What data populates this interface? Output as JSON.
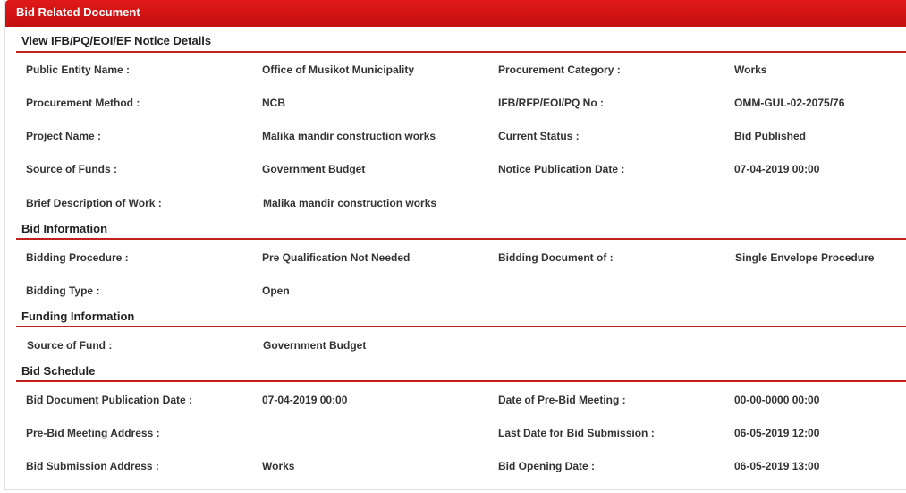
{
  "panel": {
    "title": "Bid Related Document"
  },
  "sections": {
    "notice": {
      "title": "View IFB/PQ/EOI/EF Notice Details",
      "public_entity_label": "Public Entity Name :",
      "public_entity_value": "Office of Musikot Municipality",
      "procurement_category_label": "Procurement Category :",
      "procurement_category_value": "Works",
      "procurement_method_label": "Procurement Method :",
      "procurement_method_value": "NCB",
      "ifb_no_label": "IFB/RFP/EOI/PQ No :",
      "ifb_no_value": "OMM-GUL-02-2075/76",
      "project_name_label": "Project Name :",
      "project_name_value": "Malika mandir construction works",
      "current_status_label": "Current Status :",
      "current_status_value": "Bid Published",
      "source_of_funds_label": "Source of Funds :",
      "source_of_funds_value": "Government Budget",
      "notice_pub_date_label": "Notice Publication Date :",
      "notice_pub_date_value": "07-04-2019 00:00",
      "brief_desc_label": "Brief Description of Work :",
      "brief_desc_value": "Malika mandir construction works"
    },
    "bid_info": {
      "title": "Bid Information",
      "bidding_procedure_label": "Bidding Procedure :",
      "bidding_procedure_value": "Pre Qualification Not Needed",
      "bidding_document_label": "Bidding Document of :",
      "bidding_document_value": "Single Envelope Procedure",
      "bidding_type_label": "Bidding Type :",
      "bidding_type_value": "Open"
    },
    "funding": {
      "title": "Funding Information",
      "source_of_fund_label": "Source of Fund :",
      "source_of_fund_value": "Government Budget"
    },
    "schedule": {
      "title": "Bid Schedule",
      "doc_pub_date_label": "Bid Document Publication Date :",
      "doc_pub_date_value": "07-04-2019 00:00",
      "prebid_date_label": "Date of Pre-Bid Meeting :",
      "prebid_date_value": "00-00-0000 00:00",
      "prebid_address_label": "Pre-Bid Meeting Address :",
      "prebid_address_value": "",
      "last_submission_label": "Last Date for Bid Submission :",
      "last_submission_value": "06-05-2019 12:00",
      "submission_address_label": "Bid Submission Address :",
      "submission_address_value": "Works",
      "opening_date_label": "Bid Opening Date :",
      "opening_date_value": "06-05-2019 13:00"
    }
  }
}
